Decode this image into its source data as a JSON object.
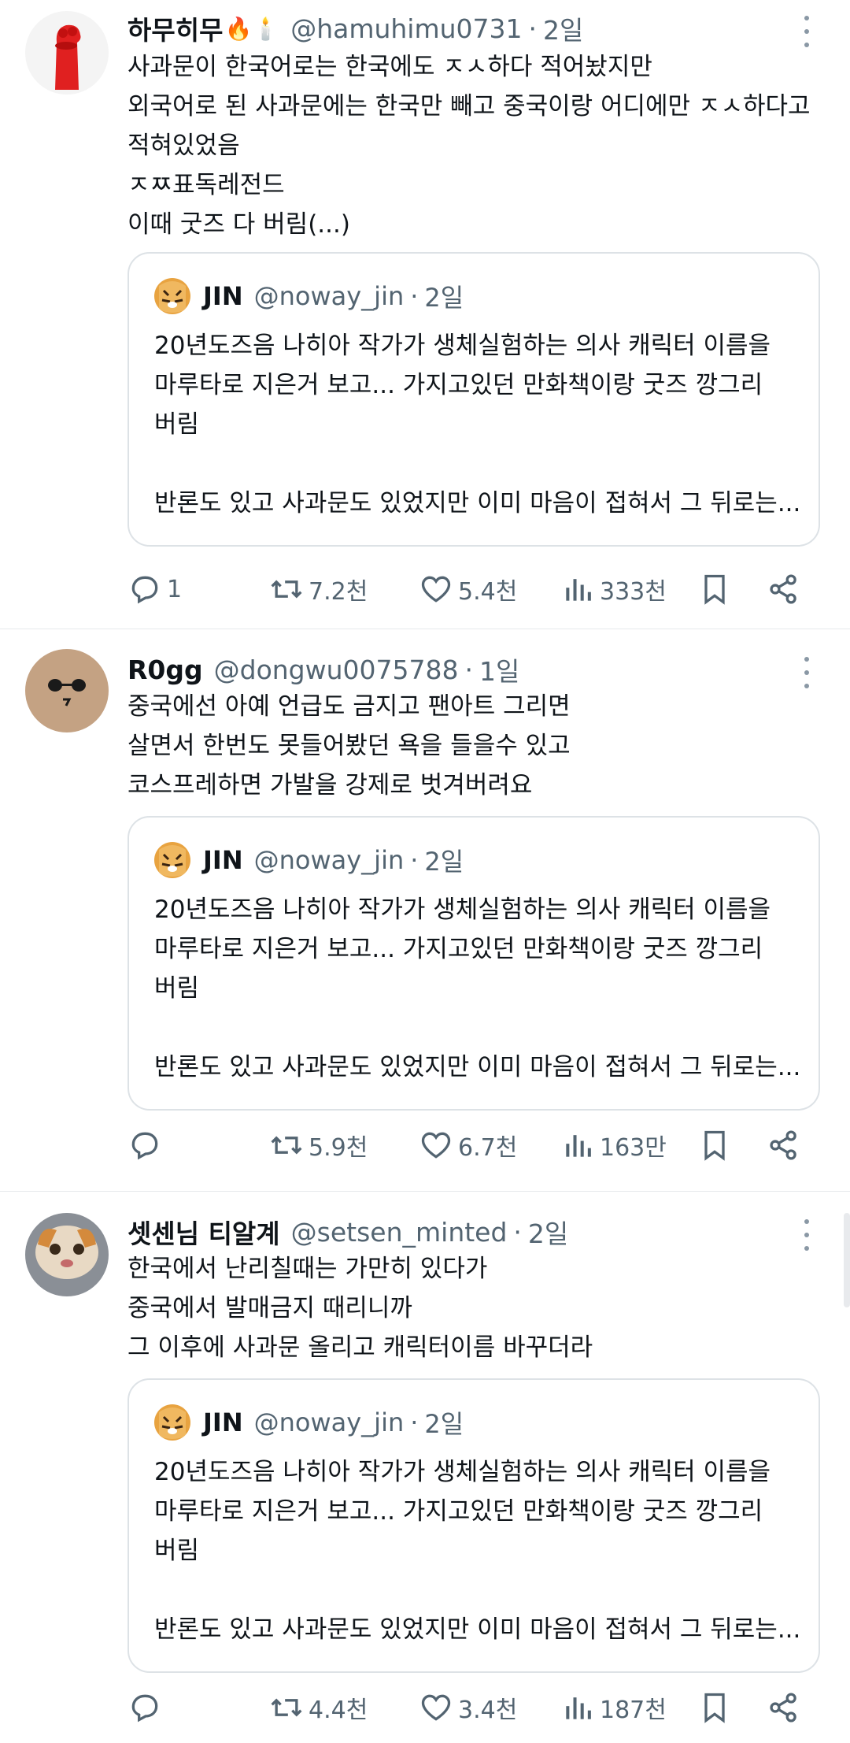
{
  "tweets": [
    {
      "name": "하무히무",
      "emoji": "🔥🕯️",
      "handle": "@hamuhimu0731",
      "time": "2일",
      "body": [
        "사과문이 한국어로는 한국에도 ㅈㅅ하다 적어놨지만",
        "외국어로 된 사과문에는 한국만 빼고 중국이랑 어디에만 ㅈㅅ하다고",
        "적혀있었음",
        "ㅈㅉ표독레전드",
        "이때 굿즈 다 버림(...)"
      ],
      "quote": {
        "name": "JIN",
        "handle": "@noway_jin",
        "time": "2일",
        "body": [
          "20년도즈음 나히아 작가가 생체실험하는 의사 캐릭터 이름을",
          "마루타로 지은거 보고... 가지고있던 만화책이랑 굿즈 깡그리",
          "버림",
          "",
          "반론도 있고 사과문도 있었지만 이미 마음이 접혀서 그 뒤로는..."
        ]
      },
      "stats": {
        "replies": "1",
        "retweets": "7.2천",
        "likes": "5.4천",
        "views": "333천"
      }
    },
    {
      "name": "R0gg",
      "emoji": "",
      "handle": "@dongwu0075788",
      "time": "1일",
      "body": [
        "중국에선 아예 언급도 금지고 팬아트 그리면",
        "살면서 한번도 못들어봤던 욕을 들을수 있고",
        "코스프레하면 가발을 강제로 벗겨버려요"
      ],
      "quote": {
        "name": "JIN",
        "handle": "@noway_jin",
        "time": "2일",
        "body": [
          "20년도즈음 나히아 작가가 생체실험하는 의사 캐릭터 이름을",
          "마루타로 지은거 보고... 가지고있던 만화책이랑 굿즈 깡그리",
          "버림",
          "",
          "반론도 있고 사과문도 있었지만 이미 마음이 접혀서 그 뒤로는..."
        ]
      },
      "stats": {
        "replies": "",
        "retweets": "5.9천",
        "likes": "6.7천",
        "views": "163만"
      }
    },
    {
      "name": "셋센님 티알계",
      "emoji": "",
      "handle": "@setsen_minted",
      "time": "2일",
      "body": [
        "한국에서 난리칠때는 가만히 있다가",
        "중국에서 발매금지 때리니까",
        "그 이후에 사과문 올리고 캐릭터이름 바꾸더라"
      ],
      "quote": {
        "name": "JIN",
        "handle": "@noway_jin",
        "time": "2일",
        "body": [
          "20년도즈음 나히아 작가가 생체실험하는 의사 캐릭터 이름을",
          "마루타로 지은거 보고... 가지고있던 만화책이랑 굿즈 깡그리",
          "버림",
          "",
          "반론도 있고 사과문도 있었지만 이미 마음이 접혀서 그 뒤로는..."
        ]
      },
      "stats": {
        "replies": "",
        "retweets": "4.4천",
        "likes": "3.4천",
        "views": "187천"
      }
    }
  ],
  "icons": {
    "reply": "reply-icon",
    "retweet": "retweet-icon",
    "like": "heart-icon",
    "views": "views-icon",
    "bookmark": "bookmark-icon",
    "share": "share-icon",
    "more": "more-icon"
  },
  "colors": {
    "text": "#0f1419",
    "muted": "#536471",
    "border": "#dde2e6"
  }
}
